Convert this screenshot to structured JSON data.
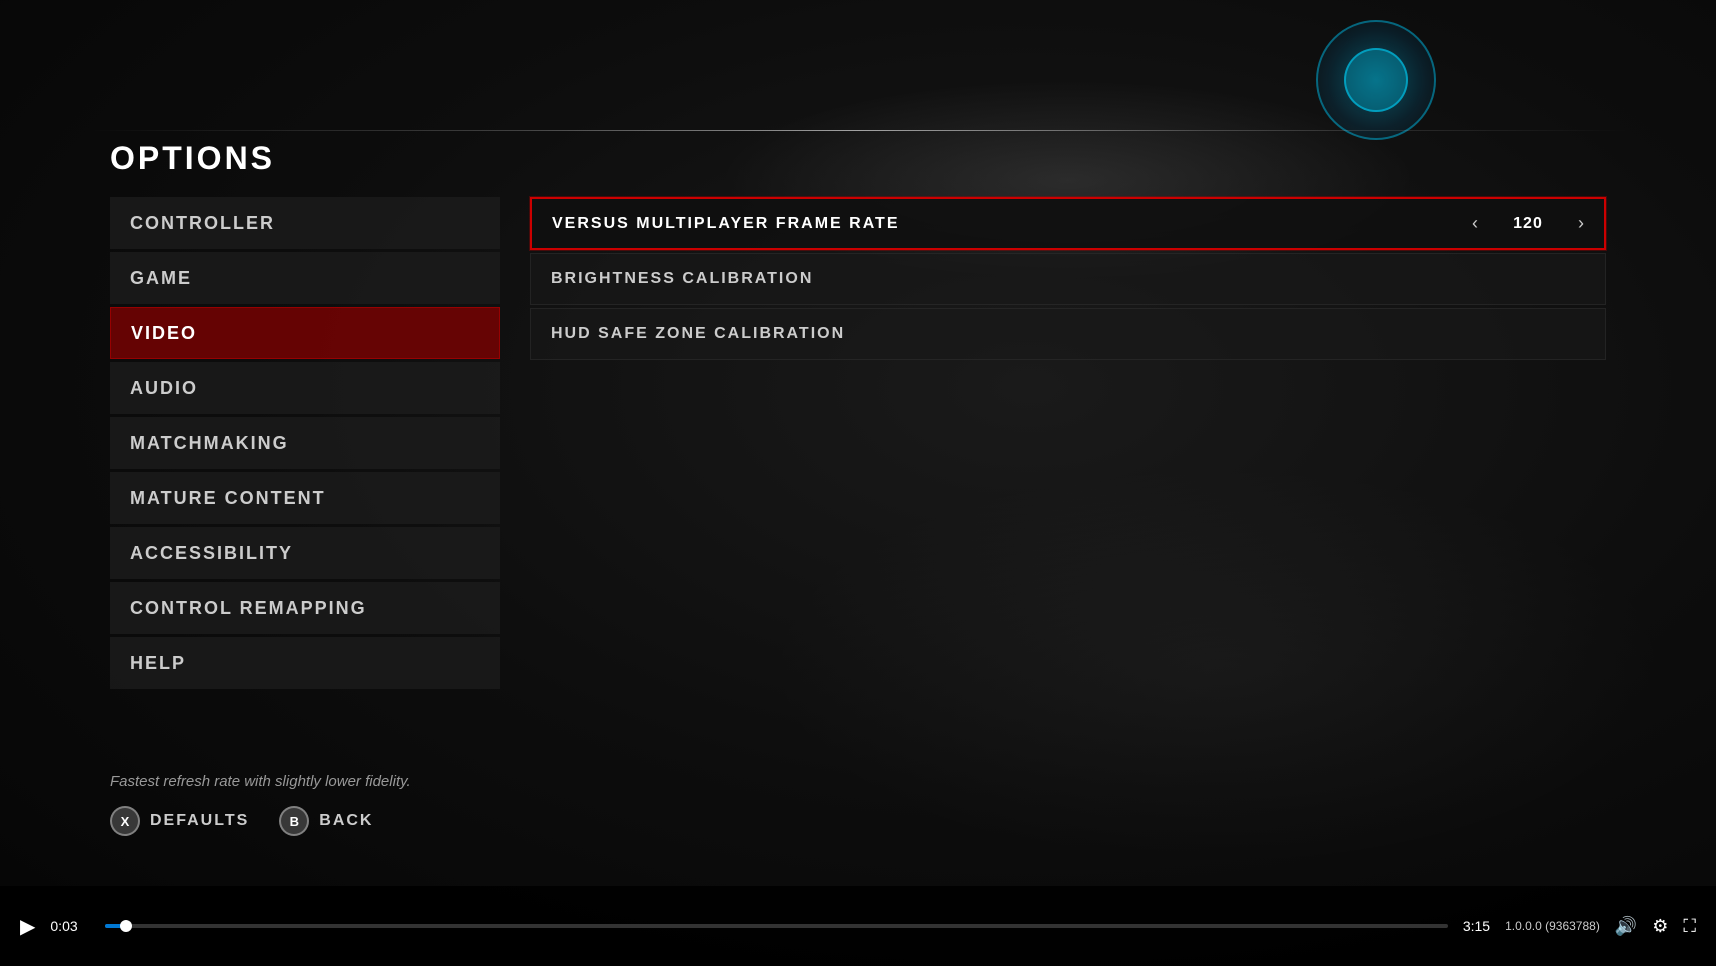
{
  "page": {
    "title": "OPTIONS"
  },
  "sidebar": {
    "items": [
      {
        "id": "controller",
        "label": "CONTROLLER",
        "active": false
      },
      {
        "id": "game",
        "label": "GAME",
        "active": false
      },
      {
        "id": "video",
        "label": "VIDEO",
        "active": true
      },
      {
        "id": "audio",
        "label": "AUDIO",
        "active": false
      },
      {
        "id": "matchmaking",
        "label": "MATCHMAKING",
        "active": false
      },
      {
        "id": "mature-content",
        "label": "MATURE CONTENT",
        "active": false
      },
      {
        "id": "accessibility",
        "label": "ACCESSIBILITY",
        "active": false
      },
      {
        "id": "control-remapping",
        "label": "CONTROL REMAPPING",
        "active": false
      },
      {
        "id": "help",
        "label": "HELP",
        "active": false
      }
    ]
  },
  "settings": {
    "items": [
      {
        "id": "versus-frame-rate",
        "label": "VERSUS MULTIPLAYER FRAME RATE",
        "value": "120",
        "focused": true,
        "hasArrows": true
      },
      {
        "id": "brightness",
        "label": "BRIGHTNESS CALIBRATION",
        "value": "",
        "focused": false,
        "hasArrows": false
      },
      {
        "id": "hud-safe-zone",
        "label": "HUD SAFE ZONE CALIBRATION",
        "value": "",
        "focused": false,
        "hasArrows": false
      }
    ]
  },
  "hint": {
    "text": "Fastest refresh rate with slightly lower fidelity."
  },
  "buttons": [
    {
      "id": "defaults",
      "icon": "X",
      "label": "DEFAULTS"
    },
    {
      "id": "back",
      "icon": "B",
      "label": "BACK"
    }
  ],
  "video_player": {
    "time_current": "0:03",
    "time_total": "3:15",
    "progress_percent": 1.6,
    "version": "1.0.0.0 (9363788)",
    "play_icon": "▶",
    "volume_icon": "🔊",
    "settings_icon": "⚙",
    "fullscreen_icon": "⛶"
  }
}
